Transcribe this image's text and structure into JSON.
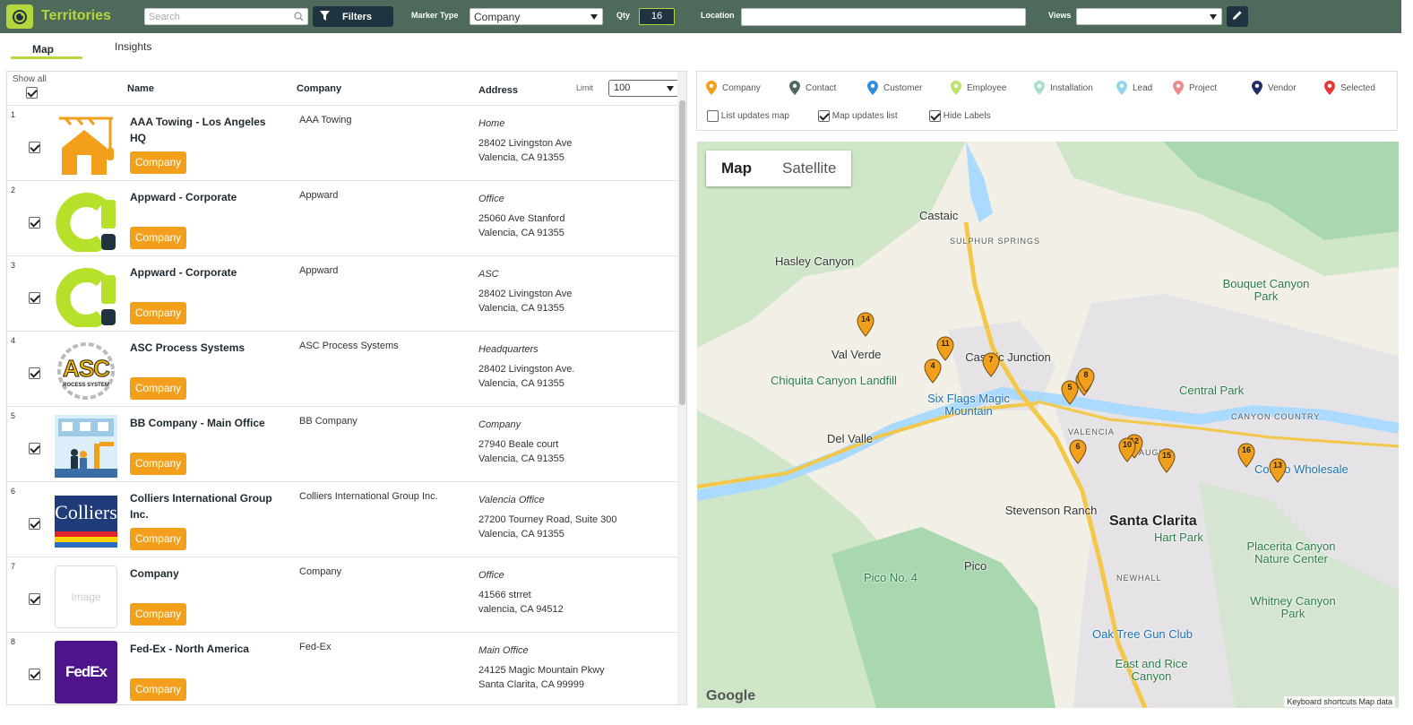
{
  "header": {
    "title": "Territories",
    "search_placeholder": "Search",
    "filters_label": "Filters",
    "marker_type_label": "Marker Type",
    "marker_type_value": "Company",
    "qty_label": "Qty",
    "qty_value": "16",
    "location_label": "Location",
    "views_label": "Views",
    "views_value": ""
  },
  "tabs": [
    {
      "label": "Map",
      "active": true
    },
    {
      "label": "Insights",
      "active": false
    }
  ],
  "list": {
    "show_all_label": "Show all",
    "columns": {
      "name": "Name",
      "company": "Company",
      "address": "Address"
    },
    "limit_label": "Limit",
    "limit_value": "100",
    "rows": [
      {
        "num": "1",
        "name": "AAA Towing - Los Angeles HQ",
        "badge": "Company",
        "company": "AAA Towing",
        "type": "Home",
        "addr1": "28402 Livingston Ave",
        "addr2": "Valencia, CA 91355",
        "thumb": "construction-house-icon"
      },
      {
        "num": "2",
        "name": "Appward - Corporate",
        "badge": "Company",
        "company": "Appward",
        "type": "Office",
        "addr1": "25060 Ave Stanford",
        "addr2": "Valencia, CA 91355",
        "thumb": "appward-logo"
      },
      {
        "num": "3",
        "name": "Appward - Corporate",
        "badge": "Company",
        "company": "Appward",
        "type": "ASC",
        "addr1": "28402 Livingston Ave",
        "addr2": "Valencia, CA 91355",
        "thumb": "appward-logo"
      },
      {
        "num": "4",
        "name": "ASC Process Systems",
        "badge": "Company",
        "company": "ASC Process Systems",
        "type": "Headquarters",
        "addr1": "28402 Livingston Ave.",
        "addr2": "Valencia, CA 91355",
        "thumb": "asc-logo",
        "thumb_text": "ASC",
        "thumb_sub": "ROCESS SYSTEM"
      },
      {
        "num": "5",
        "name": "BB Company  - Main Office",
        "badge": "Company",
        "company": "BB Company",
        "type": "Company",
        "addr1": "27940 Beale court",
        "addr2": "Valencia, CA 91355",
        "thumb": "factory-illustration"
      },
      {
        "num": "6",
        "name": "Colliers International Group Inc.",
        "badge": "Company",
        "company": "Colliers International Group Inc.",
        "type": "Valencia Office",
        "addr1": "27200 Tourney Road, Suite 300",
        "addr2": "Valencia, CA 91355",
        "thumb": "colliers-logo",
        "thumb_text": "Colliers"
      },
      {
        "num": "7",
        "name": "Company",
        "badge": "Company",
        "company": "Company",
        "type": "Office",
        "addr1": "41566 strret",
        "addr2": "valencia, CA 94512",
        "thumb": "image-placeholder",
        "thumb_text": "Image"
      },
      {
        "num": "8",
        "name": "Fed-Ex - North America",
        "badge": "Company",
        "company": "Fed-Ex",
        "type": "Main Office",
        "addr1": "24125 Magic Mountain Pkwy",
        "addr2": "Santa Clarita, CA 99999",
        "thumb": "fedex-logo",
        "thumb_text": "FedEx"
      }
    ]
  },
  "legend": {
    "items": [
      {
        "label": "Company",
        "color": "#f2a01c"
      },
      {
        "label": "Contact",
        "color": "#4d6a5b"
      },
      {
        "label": "Customer",
        "color": "#2f8be0"
      },
      {
        "label": "Employee",
        "color": "#b9e36d"
      },
      {
        "label": "Installation",
        "color": "#a9e0c9"
      },
      {
        "label": "Lead",
        "color": "#8fd6ee"
      },
      {
        "label": "Project",
        "color": "#f08a8a"
      },
      {
        "label": "Vendor",
        "color": "#1f2d6b"
      },
      {
        "label": "Selected",
        "color": "#e53935"
      }
    ],
    "checks": [
      {
        "label": "List updates map",
        "checked": false
      },
      {
        "label": "Map updates list",
        "checked": true
      },
      {
        "label": "Hide Labels",
        "checked": true
      }
    ]
  },
  "map": {
    "tabs": [
      "Map",
      "Satellite"
    ],
    "labels": [
      "Castaic",
      "SULPHUR SPRINGS",
      "Hasley Canyon",
      "Val Verde",
      "Castaic Junction",
      "Chiquita Canyon Landfill",
      "Six Flags Magic Mountain",
      "Del Valle",
      "VALENCIA",
      "SAUGUS",
      "Central Park",
      "CANYON COUNTRY",
      "Bouquet Canyon Park",
      "Costco Wholesale",
      "Stevenson Ranch",
      "Santa Clarita",
      "Hart Park",
      "Placerita Canyon Nature Center",
      "Pico",
      "Pico No. 4",
      "NEWHALL",
      "Whitney Canyon Park",
      "Oak Tree Gun Club",
      "East and Rice Canyon"
    ],
    "markers": [
      "14",
      "11",
      "4",
      "7",
      "9",
      "5",
      "8",
      "12",
      "6",
      "10",
      "15",
      "16",
      "13"
    ],
    "google": "Google",
    "keyboard": "Keyboard shortcuts",
    "map_data": "Map data"
  }
}
